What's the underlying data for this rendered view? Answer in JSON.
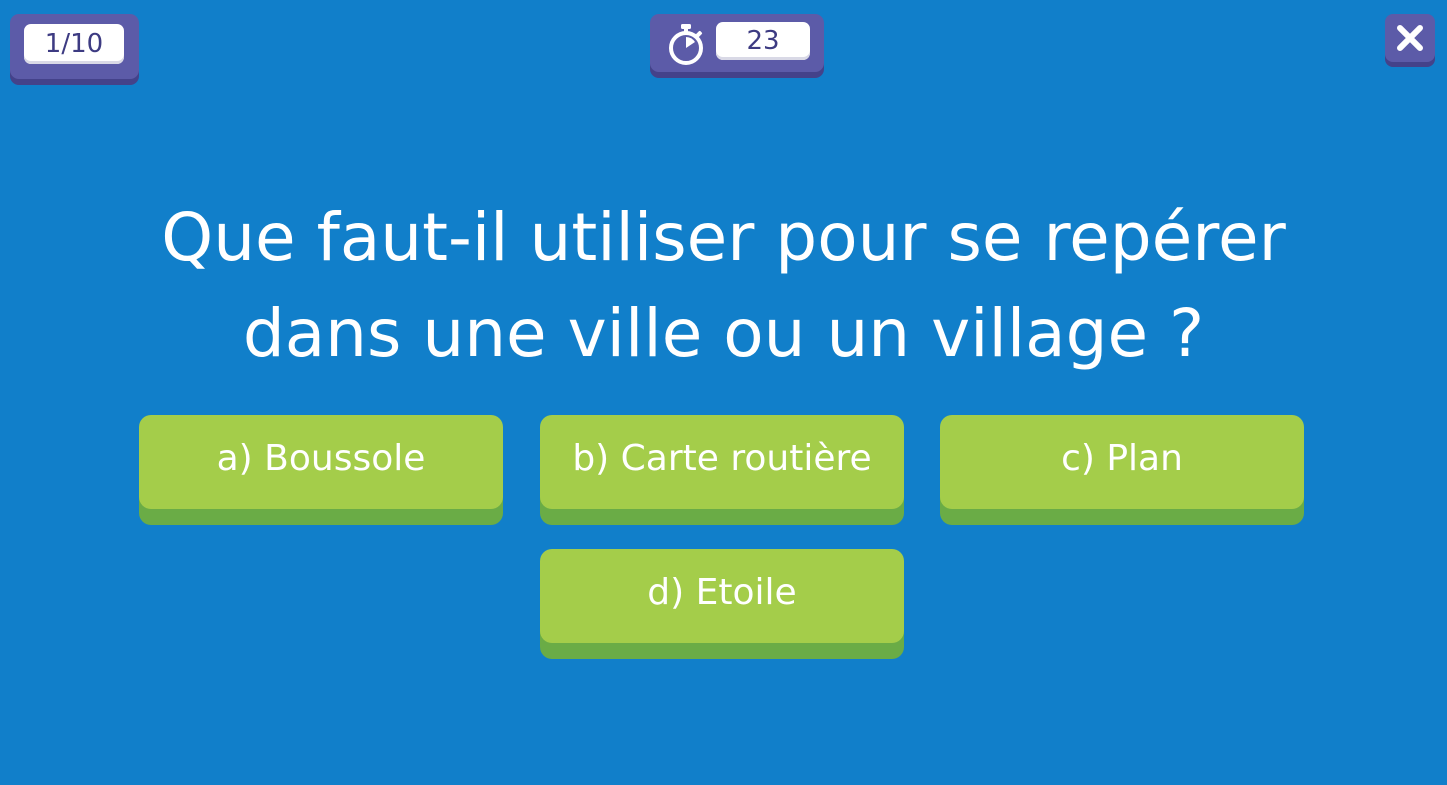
{
  "header": {
    "progress": "1/10",
    "timer_seconds": "23",
    "timer_icon": "stopwatch-icon",
    "close_icon": "close-icon"
  },
  "question": {
    "line1": "Que faut-il utiliser pour se repérer",
    "line2": "dans une ville ou un village ?"
  },
  "answers": [
    {
      "label": "a) Boussole"
    },
    {
      "label": "b) Carte routière"
    },
    {
      "label": "c) Plan"
    },
    {
      "label": "d) Etoile"
    }
  ],
  "colors": {
    "background": "#117fca",
    "panel": "#5c5ba8",
    "panel_shadow": "#44428a",
    "answer": "#a4cd4a",
    "answer_shadow": "#6aac46"
  }
}
